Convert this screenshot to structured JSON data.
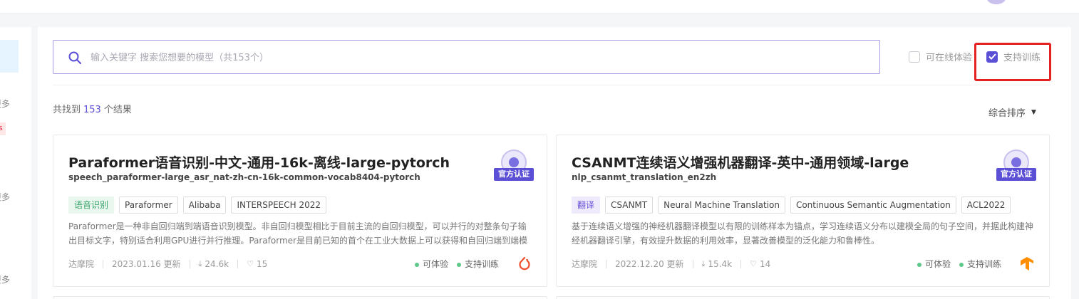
{
  "search": {
    "placeholder": "输入关键字 搜索您想要的模型（共153个）"
  },
  "filters": {
    "online_trial_label": "可在线体验",
    "online_trial_checked": false,
    "support_training_label": "支持训练",
    "support_training_checked": true
  },
  "results": {
    "prefix": "共找到",
    "count": "153",
    "suffix": "个结果"
  },
  "sort": {
    "label": "综合排序",
    "arrow": "▼"
  },
  "sidebar": {
    "more_label": "更多",
    "tag_partial": "s"
  },
  "cards": [
    {
      "title": "Paraformer语音识别-中文-通用-16k-离线-large-pytorch",
      "model_id": "speech_paraformer-large_asr_nat-zh-cn-16k-common-vocab8404-pytorch",
      "badge": "官方认证",
      "tags": [
        "语音识别",
        "Paraformer",
        "Alibaba",
        "INTERSPEECH 2022"
      ],
      "description": "Paraformer是一种非自回归端到端语音识别模型。非自回归模型相比于目前主流的自回归模型，可以并行的对整条句子输出目标文字，特别适合利用GPU进行并行推理。Paraformer是目前已知的首个在工业大数据上可以获得和自回归端到端模型…",
      "org": "达摩院",
      "updated": "2023.01.16 更新",
      "downloads": "24.6k",
      "likes": "15",
      "status_trial": "可体验",
      "status_training": "支持训练",
      "framework_icon": "pytorch-icon",
      "framework_color": "#ee4c2c"
    },
    {
      "title": "CSANMT连续语义增强机器翻译-英中-通用领域-large",
      "model_id": "nlp_csanmt_translation_en2zh",
      "badge": "官方认证",
      "tags": [
        "翻译",
        "CSANMT",
        "Neural Machine Translation",
        "Continuous Semantic Augmentation",
        "ACL2022"
      ],
      "description": "基于连续语义增强的神经机器翻译模型以有限的训练样本为锚点，学习连续语义分布以建模全局的句子空间，并据此构建神经机器翻译引擎，有效提升数据的利用效率，显著改善模型的泛化能力和鲁棒性。",
      "org": "达摩院",
      "updated": "2022.12.20 更新",
      "downloads": "15.4k",
      "likes": "14",
      "status_trial": "可体验",
      "status_training": "支持训练",
      "framework_icon": "tensorflow-icon",
      "framework_color": "#ff8f00"
    }
  ],
  "colors": {
    "accent": "#5b4fd6",
    "highlight_border": "#e52222",
    "status_dot": "#5cc98b"
  }
}
